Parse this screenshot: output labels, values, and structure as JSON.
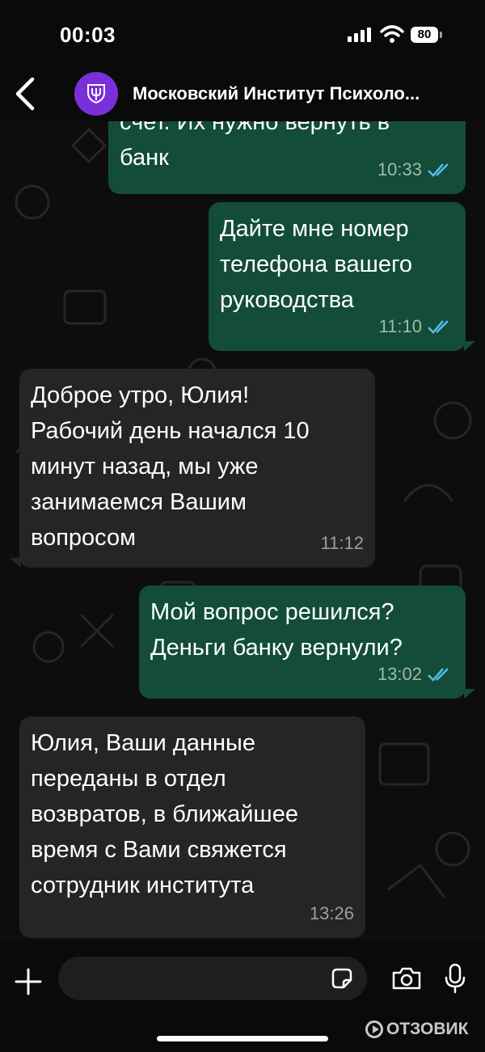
{
  "status_bar": {
    "time": "00:03",
    "battery": "80"
  },
  "header": {
    "title": "Московский Институт Психоло...",
    "avatar_color": "#7b2fd9"
  },
  "messages": [
    {
      "direction": "outgoing",
      "text": "счет. Их нужно вернуть в\nбанк",
      "time": "10:33",
      "status": "read"
    },
    {
      "direction": "outgoing",
      "text": "Дайте мне номер\nтелефона вашего\nруководства",
      "time": "11:10",
      "status": "read"
    },
    {
      "direction": "incoming",
      "text": "Доброе утро, Юлия!\nРабочий день начался 10\nминут назад, мы уже\nзанимаемся Вашим\nвопросом",
      "time": "11:12"
    },
    {
      "direction": "outgoing",
      "text": "Мой вопрос решился?\nДеньги банку вернули?",
      "time": "13:02",
      "status": "read"
    },
    {
      "direction": "incoming",
      "text": "Юлия, Ваши данные\nпереданы в отдел\nвозвратов, в ближайшее\nвремя с Вами свяжется\nсотрудник института",
      "time": "13:26"
    }
  ],
  "composer": {
    "placeholder": ""
  },
  "watermark": "ОТЗОВИК",
  "colors": {
    "outgoing_bubble": "#134d37",
    "incoming_bubble": "#242626",
    "read_ticks": "#53bdeb"
  }
}
